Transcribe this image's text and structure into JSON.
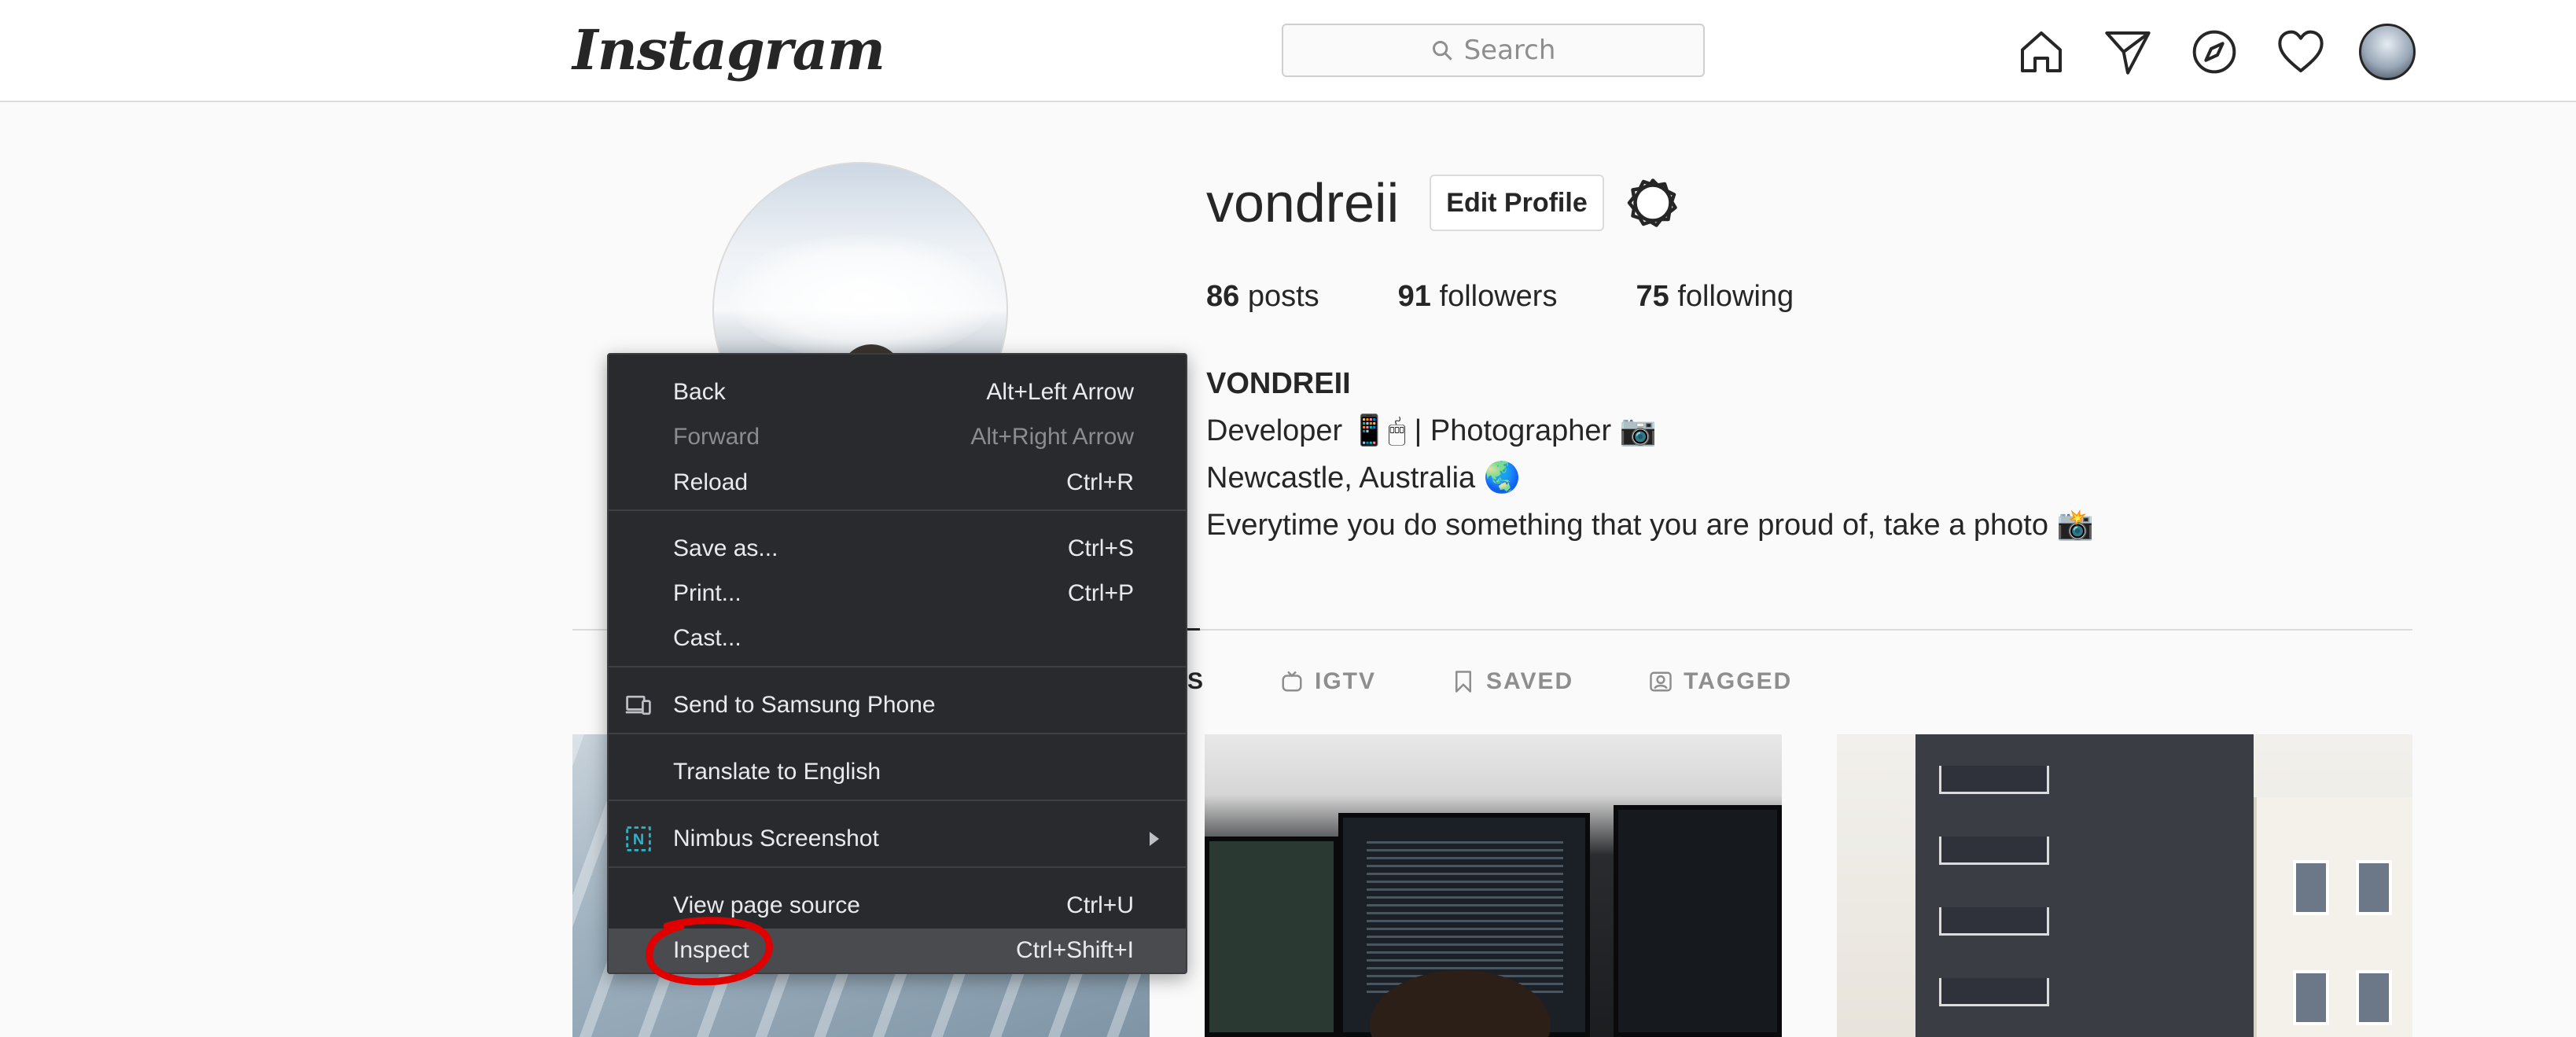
{
  "topbar": {
    "logo": "Instagram",
    "search_placeholder": "Search",
    "icons": [
      "home-icon",
      "direct-send-icon",
      "explore-compass-icon",
      "activity-heart-icon",
      "profile-avatar"
    ]
  },
  "profile": {
    "username": "vondreii",
    "edit_button": "Edit Profile",
    "stats": {
      "posts_count": "86",
      "posts_label": "posts",
      "followers_count": "91",
      "followers_label": "followers",
      "following_count": "75",
      "following_label": "following"
    },
    "bio": {
      "name": "VONDREII",
      "line1": "Developer 📱🖱 | Photographer 📷",
      "line2": "Newcastle, Australia 🌏",
      "line3": "Everytime you do something that you are proud of, take a photo 📸"
    }
  },
  "tabs": {
    "posts_partial": "S",
    "igtv": "IGTV",
    "saved": "SAVED",
    "tagged": "TAGGED"
  },
  "context_menu": {
    "items": [
      {
        "label": "Back",
        "shortcut": "Alt+Left Arrow"
      },
      {
        "label": "Forward",
        "shortcut": "Alt+Right Arrow",
        "disabled": true
      },
      {
        "label": "Reload",
        "shortcut": "Ctrl+R"
      },
      {
        "label": "Save as...",
        "shortcut": "Ctrl+S"
      },
      {
        "label": "Print...",
        "shortcut": "Ctrl+P"
      },
      {
        "label": "Cast...",
        "shortcut": ""
      },
      {
        "label": "Send to Samsung Phone",
        "shortcut": ""
      },
      {
        "label": "Translate to English",
        "shortcut": ""
      },
      {
        "label": "Nimbus Screenshot",
        "shortcut": ""
      },
      {
        "label": "View page source",
        "shortcut": "Ctrl+U"
      },
      {
        "label": "Inspect",
        "shortcut": "Ctrl+Shift+I",
        "highlighted": true
      }
    ]
  },
  "colors": {
    "menu_bg": "#292a2d",
    "menu_highlight": "#4a4b4f",
    "annotation_red": "#e00000",
    "nimbus_icon": "#2fb3c8"
  }
}
